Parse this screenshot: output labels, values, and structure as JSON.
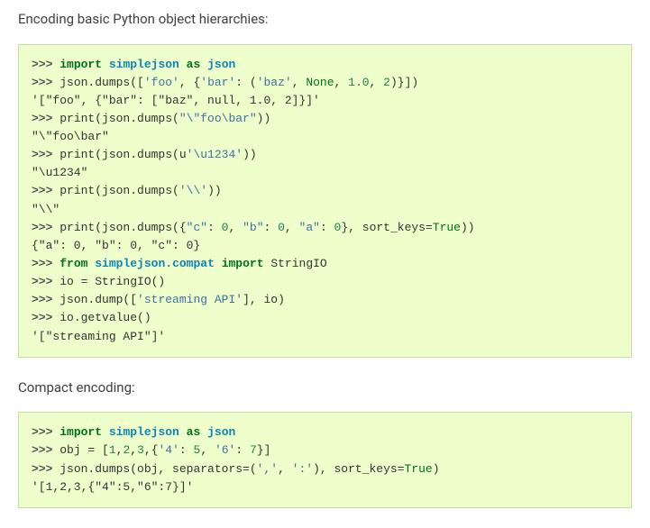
{
  "section1_text": "Encoding basic Python object hierarchies:",
  "code1": {
    "l1_gp": ">>> ",
    "l1_kw1": "import",
    "l1_sp1": " ",
    "l1_mod": "simplejson",
    "l1_sp2": " ",
    "l1_kw2": "as",
    "l1_sp3": " ",
    "l1_alias": "json",
    "l2_gp": ">>> ",
    "l2_a": "json.dumps([",
    "l2_s1": "'foo'",
    "l2_b": ", {",
    "l2_s2": "'bar'",
    "l2_c": ": (",
    "l2_s3": "'baz'",
    "l2_d": ", ",
    "l2_none": "None",
    "l2_e": ", ",
    "l2_n1": "1.0",
    "l2_f": ", ",
    "l2_n2": "2",
    "l2_g": ")}])",
    "l3_out": "'[\"foo\", {\"bar\": [\"baz\", null, 1.0, 2]}]'",
    "l4_gp": ">>> ",
    "l4_a": "print(json.dumps(",
    "l4_s": "\"\\\"foo\\bar\"",
    "l4_b": "))",
    "l5_out": "\"\\\"foo\\bar\"",
    "l6_gp": ">>> ",
    "l6_a": "print(json.dumps(u",
    "l6_s": "'\\u1234'",
    "l6_b": "))",
    "l7_out": "\"\\u1234\"",
    "l8_gp": ">>> ",
    "l8_a": "print(json.dumps(",
    "l8_s": "'\\\\'",
    "l8_b": "))",
    "l9_out": "\"\\\\\"",
    "l10_gp": ">>> ",
    "l10_a": "print(json.dumps({",
    "l10_s1": "\"c\"",
    "l10_b": ": ",
    "l10_n1": "0",
    "l10_c": ", ",
    "l10_s2": "\"b\"",
    "l10_d": ": ",
    "l10_n2": "0",
    "l10_e": ", ",
    "l10_s3": "\"a\"",
    "l10_f": ": ",
    "l10_n3": "0",
    "l10_g": "}, sort_keys=",
    "l10_true": "True",
    "l10_h": "))",
    "l11_out": "{\"a\": 0, \"b\": 0, \"c\": 0}",
    "l12_gp": ">>> ",
    "l12_kw1": "from",
    "l12_sp1": " ",
    "l12_mod": "simplejson.compat",
    "l12_sp2": " ",
    "l12_kw2": "import",
    "l12_sp3": " ",
    "l12_name": "StringIO",
    "l13_gp": ">>> ",
    "l13_txt": "io = StringIO()",
    "l14_gp": ">>> ",
    "l14_a": "json.dump([",
    "l14_s": "'streaming API'",
    "l14_b": "], io)",
    "l15_gp": ">>> ",
    "l15_txt": "io.getvalue()",
    "l16_out": "'[\"streaming API\"]'"
  },
  "section2_text": "Compact encoding:",
  "code2": {
    "l1_gp": ">>> ",
    "l1_kw1": "import",
    "l1_sp1": " ",
    "l1_mod": "simplejson",
    "l1_sp2": " ",
    "l1_kw2": "as",
    "l1_sp3": " ",
    "l1_alias": "json",
    "l2_gp": ">>> ",
    "l2_a": "obj = [",
    "l2_n1": "1",
    "l2_b": ",",
    "l2_n2": "2",
    "l2_c": ",",
    "l2_n3": "3",
    "l2_d": ",{",
    "l2_s1": "'4'",
    "l2_e": ": ",
    "l2_n4": "5",
    "l2_f": ", ",
    "l2_s2": "'6'",
    "l2_g": ": ",
    "l2_n5": "7",
    "l2_h": "}]",
    "l3_gp": ">>> ",
    "l3_a": "json.dumps(obj, separators=(",
    "l3_s1": "','",
    "l3_b": ", ",
    "l3_s2": "':'",
    "l3_c": "), sort_keys=",
    "l3_true": "True",
    "l3_d": ")",
    "l4_out": "'[1,2,3,{\"4\":5,\"6\":7}]'"
  }
}
